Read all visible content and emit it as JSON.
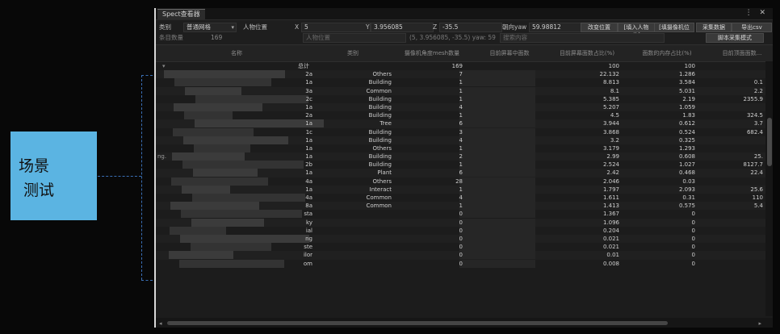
{
  "annotation": {
    "line1": "场景",
    "line2": "测试"
  },
  "window": {
    "tab_title": "Spect查看器",
    "controls": "⋮ ✕"
  },
  "toolbar": {
    "row1": {
      "category_label": "类别",
      "category_value": "普通网格",
      "position_label": "人物位置",
      "x_label": "X",
      "x_value": "5",
      "y_label": "Y",
      "y_value": "3.956085",
      "z_label": "Z",
      "z_value": "-35.5",
      "yaw_label": "朝向yaw",
      "yaw_value": "59.98812",
      "btn_change_pos": "改变位置",
      "btn_char_pos": "[填入人物位]",
      "btn_cam_pos": "[填摄像机位",
      "btn_collect": "采集数据",
      "btn_export": "导出csv"
    },
    "row2": {
      "count_label": "条目数量",
      "count_value": "169",
      "char_pos_placeholder": "人物位置",
      "coord_readout": "(5, 3.956085, -35.5) yaw: 59",
      "search_placeholder": "搜索内容",
      "btn_script": "脚本采集模式"
    }
  },
  "table": {
    "columns": [
      "名称",
      "类别",
      "摄像机角度mesh数量",
      "目前屏幕中面数",
      "目前屏幕面数占比(%)",
      "面数的内存占比(%)",
      "目前顶面面数..."
    ],
    "total_row": {
      "label": "总计",
      "c3": "169",
      "c5": "100",
      "c6": "100"
    },
    "rows": [
      {
        "n": "2a",
        "cat": "Others",
        "m": "7",
        "p": "22.132",
        "q": "1.286",
        "r": ""
      },
      {
        "n": "1a",
        "cat": "Building",
        "m": "1",
        "p": "8.813",
        "q": "3.584",
        "r": "0.1"
      },
      {
        "n": "3a",
        "cat": "Common",
        "m": "1",
        "p": "8.1",
        "q": "5.031",
        "r": "2.2"
      },
      {
        "n": "2c",
        "cat": "Building",
        "m": "1",
        "p": "5.385",
        "q": "2.19",
        "r": "2355.9"
      },
      {
        "n": "1a",
        "cat": "Building",
        "m": "4",
        "p": "5.207",
        "q": "1.059",
        "r": ""
      },
      {
        "n": "2a",
        "cat": "Building",
        "m": "1",
        "p": "4.5",
        "q": "1.83",
        "r": "324.5"
      },
      {
        "n": "1a",
        "cat": "Tree",
        "m": "6",
        "p": "3.944",
        "q": "0.612",
        "r": "3.7"
      },
      {
        "n": "1c",
        "cat": "Building",
        "m": "3",
        "p": "3.868",
        "q": "0.524",
        "r": "682.4"
      },
      {
        "n": "1a",
        "cat": "Building",
        "m": "4",
        "p": "3.2",
        "q": "0.325",
        "r": ""
      },
      {
        "n": "1a",
        "cat": "Others",
        "m": "1",
        "p": "3.179",
        "q": "1.293",
        "r": ""
      },
      {
        "n": "1a",
        "cat": "Building",
        "m": "2",
        "p": "2.99",
        "q": "0.608",
        "r": "25."
      },
      {
        "n": "2b",
        "cat": "Building",
        "m": "1",
        "p": "2.524",
        "q": "1.027",
        "r": "8127.7"
      },
      {
        "n": "1a",
        "cat": "Plant",
        "m": "6",
        "p": "2.42",
        "q": "0.468",
        "r": "22.4"
      },
      {
        "n": "4a",
        "cat": "Others",
        "m": "28",
        "p": "2.046",
        "q": "0.03",
        "r": ""
      },
      {
        "n": "1a",
        "cat": "Interact",
        "m": "1",
        "p": "1.797",
        "q": "2.093",
        "r": "25.6"
      },
      {
        "n": "4a",
        "cat": "Common",
        "m": "4",
        "p": "1.611",
        "q": "0.31",
        "r": "110"
      },
      {
        "n": "8a",
        "cat": "Common",
        "m": "1",
        "p": "1.413",
        "q": "0.575",
        "r": "5.4"
      },
      {
        "n": "sta",
        "cat": "",
        "m": "0",
        "p": "1.367",
        "q": "0",
        "r": ""
      },
      {
        "n": "ky",
        "cat": "",
        "m": "0",
        "p": "1.096",
        "q": "0",
        "r": ""
      },
      {
        "n": "ial",
        "cat": "",
        "m": "0",
        "p": "0.204",
        "q": "0",
        "r": ""
      },
      {
        "n": "ng",
        "cat": "",
        "m": "0",
        "p": "0.021",
        "q": "0",
        "r": ""
      },
      {
        "n": "ste",
        "cat": "",
        "m": "0",
        "p": "0.021",
        "q": "0",
        "r": ""
      },
      {
        "n": "ilor",
        "cat": "",
        "m": "0",
        "p": "0.01",
        "q": "0",
        "r": ""
      },
      {
        "n": "om",
        "cat": "",
        "m": "0",
        "p": "0.008",
        "q": "0",
        "r": ""
      }
    ]
  },
  "row_prefix_ng": "ng."
}
